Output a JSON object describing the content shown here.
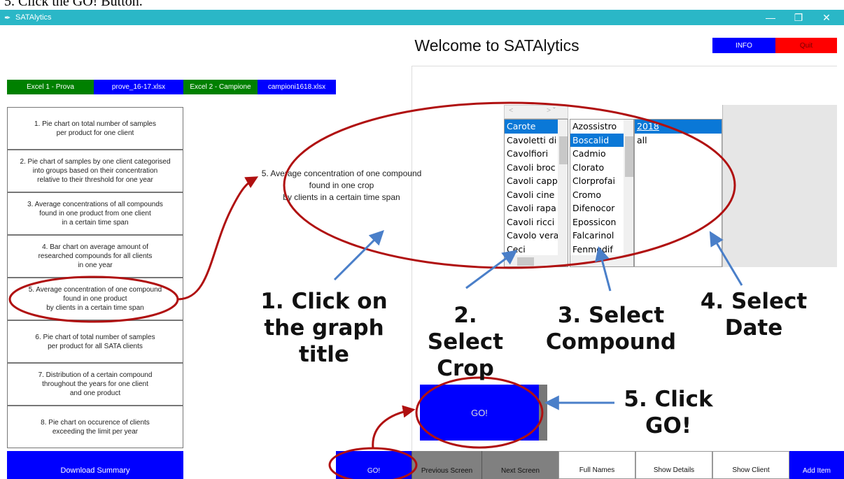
{
  "top_caption": "5.  Click the GO! Button.",
  "window": {
    "title": "SATAlytics",
    "minimize": "—",
    "restore": "❐",
    "close": "✕"
  },
  "header": {
    "welcome": "Welcome to SATAlytics",
    "info_label": "INFO",
    "quit_label": "Quit"
  },
  "files": [
    {
      "label": "Excel 1 - Prova",
      "color": "#008000"
    },
    {
      "label": "prove_16-17.xlsx",
      "color": "#0000ff"
    },
    {
      "label": "Excel 2 - Campione",
      "color": "#008000"
    },
    {
      "label": "campioni1618.xlsx",
      "color": "#0000ff"
    }
  ],
  "menu": [
    "1. Pie chart on total number of samples\nper product for one client",
    "2. Pie chart of samples by one client categorised\ninto groups based on their concentration\nrelative to their threshold for one year",
    "3. Average concentrations of all compounds\nfound in one product from one client\nin a certain time span",
    "4. Bar chart on average amount of\nresearched compounds for all clients\nin one year",
    "5. Average concentration of one compound\nfound in one product\nby clients in a certain time span",
    "6. Pie chart of total number of samples\nper product for all SATA clients",
    "7. Distribution of a certain compound\nthroughout the years for one client\nand one product",
    "8. Pie chart on occurence of clients\nexceeding the limit per year"
  ],
  "download_summary": "Download Summary",
  "selected_graph_title": "5. Average concentration of one compound\nfound in one crop\nby clients in a certain time span",
  "crops": [
    "Carote",
    "Cavoletti di",
    "Cavolfiori",
    "Cavoli broc",
    "Cavoli capp",
    "Cavoli cine",
    "Cavoli rapa",
    "Cavoli ricci",
    "Cavolo vera",
    "Ceci"
  ],
  "compounds": [
    "Azossistro",
    "Boscalid",
    "Cadmio",
    "Clorato",
    "Clorprofai",
    "Cromo",
    "Difenocor",
    "Epossicon",
    "Falcarinol",
    "Fenmedif"
  ],
  "dates": [
    "2018",
    "all"
  ],
  "go_label": "GO!",
  "bottom_bar": [
    "GO!",
    "Previous Screen",
    "Next Screen",
    "Full Names",
    "Show Details",
    "Show Client",
    "Add Item"
  ],
  "annotations": {
    "step1": "1. Click on\nthe graph\ntitle",
    "step2": "2. Select\nCrop",
    "step3": "3. Select\nCompound",
    "step4": "4. Select\nDate",
    "step5": "5. Click\nGO!"
  },
  "colors": {
    "titlebar": "#2ab7c7",
    "blue": "#0000ff",
    "red": "#ff0000",
    "green": "#008000",
    "selection": "#0a78d7",
    "annotation_red": "#b01010",
    "arrow_blue": "#4a7fc9"
  }
}
